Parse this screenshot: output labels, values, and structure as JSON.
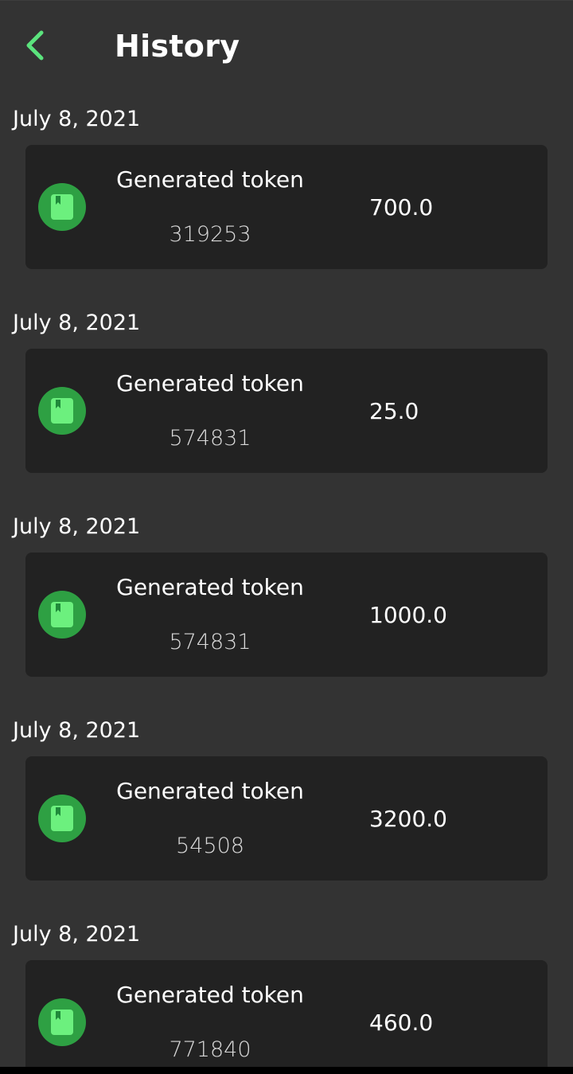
{
  "header": {
    "title": "History",
    "back_icon": "chevron-left-icon",
    "accent_color": "#5be37d"
  },
  "history": {
    "item_icon": "book-icon",
    "items": [
      {
        "date": "July 8, 2021",
        "title": "Generated token",
        "token": "319253",
        "amount": "700.0"
      },
      {
        "date": "July 8, 2021",
        "title": "Generated token",
        "token": "574831",
        "amount": "25.0"
      },
      {
        "date": "July 8, 2021",
        "title": "Generated token",
        "token": "574831",
        "amount": "1000.0"
      },
      {
        "date": "July 8, 2021",
        "title": "Generated token",
        "token": "54508",
        "amount": "3200.0"
      },
      {
        "date": "July 8, 2021",
        "title": "Generated token",
        "token": "771840",
        "amount": "460.0"
      }
    ]
  }
}
